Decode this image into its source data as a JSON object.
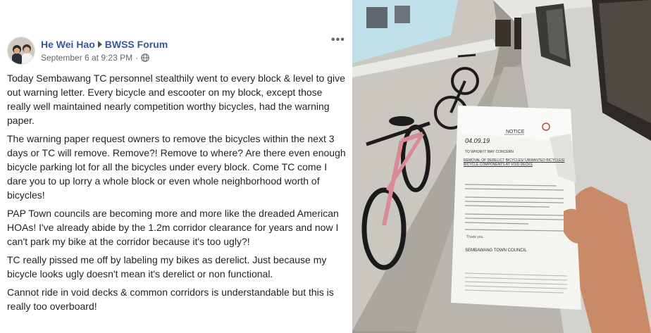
{
  "post": {
    "author": "He Wei Hao",
    "group": "BWSS Forum",
    "timestamp": "September 6 at 9:23 PM",
    "privacy_icon": "globe-icon",
    "more_label": "•••",
    "paragraphs": [
      "Today Sembawang TC personnel stealthily went to every block & level to give out warning letter. Every bicycle and escooter on my block, except those really well maintained nearly competition worthy bicycles, had the warning paper.",
      "The warning paper request owners to remove the bicycles within the next 3 days or TC will remove. Remove?! Remove to where? Are there even enough bicycle parking lot for all the bicycles under every block. Come TC come I dare you to up lorry a whole block or even whole neighborhood worth of bicycles!",
      "PAP Town councils are becoming more and more like the dreaded American HOAs! I've already abide by the 1.2m corridor clearance for years and now I can't park my bike at the corridor because it's too ugly?!",
      "TC really pissed me off by labeling my bikes as derelict. Just because my bicycle looks ugly doesn't mean it's derelict or non functional.",
      "Cannot ride in void decks & common corridors is understandable but this is really too overboard!"
    ]
  },
  "photo": {
    "notice_title": "NOTICE",
    "notice_date": "04.09.19",
    "notice_to": "TO WHOM IT MAY CONCERN",
    "notice_subject": "REMOVAL OF DERELICT BICYCLES/ UNWANTED BICYCLES/ BICYCLE COMPONENTS AT VOID DECKS",
    "notice_thanks": "Thank you.",
    "notice_signature": "SEMBAWANG TOWN COUNCIL"
  },
  "colors": {
    "link": "#365899",
    "text": "#1d2129",
    "meta": "#616770"
  }
}
